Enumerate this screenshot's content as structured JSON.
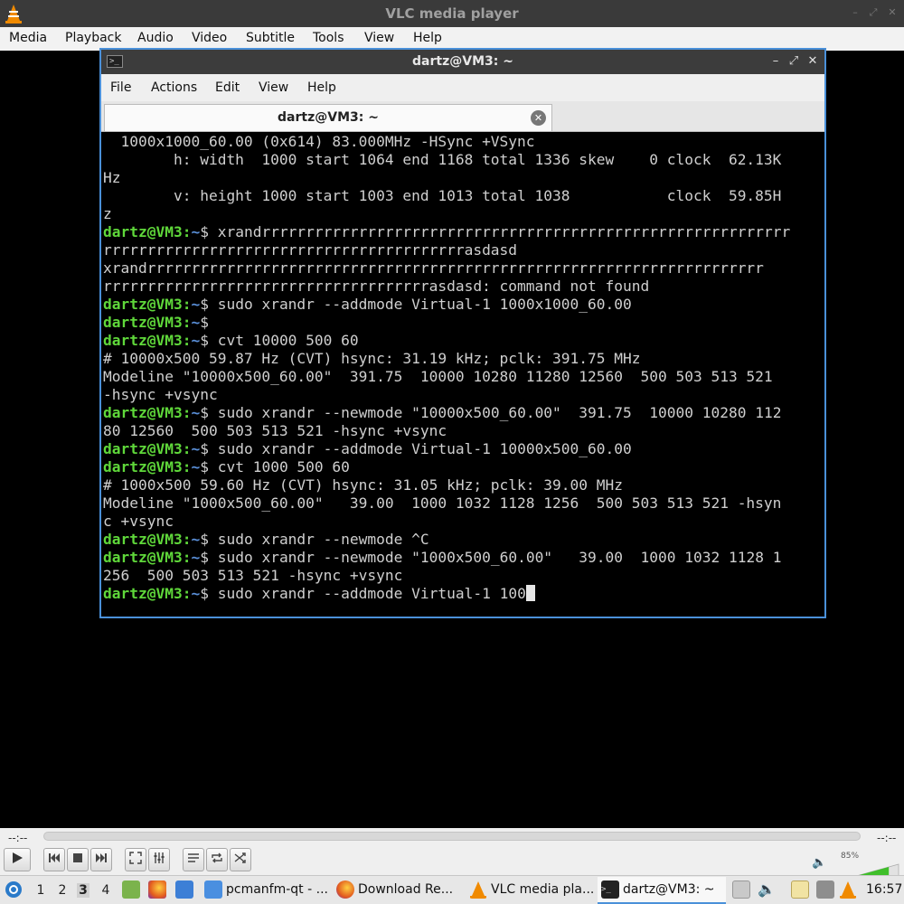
{
  "vlc": {
    "title": "VLC media player",
    "menu": [
      "Media",
      "Playback",
      "Audio",
      "Video",
      "Subtitle",
      "Tools",
      "View",
      "Help"
    ],
    "time_elapsed": "--:--",
    "time_total": "--:--",
    "volume": "85%",
    "volume_level": 0.85
  },
  "terminal": {
    "title": "dartz@VM3: ~",
    "menu": [
      "File",
      "Actions",
      "Edit",
      "View",
      "Help"
    ],
    "tab_label": "dartz@VM3: ~",
    "prompt_user": "dartz@VM3",
    "prompt_sep": ":",
    "prompt_path": "~",
    "prompt_dollar": "$ ",
    "lines": [
      {
        "type": "out",
        "text": "  1000x1000_60.00 (0x614) 83.000MHz -HSync +VSync"
      },
      {
        "type": "out",
        "text": "        h: width  1000 start 1064 end 1168 total 1336 skew    0 clock  62.13K"
      },
      {
        "type": "out",
        "text": "Hz"
      },
      {
        "type": "out",
        "text": "        v: height 1000 start 1003 end 1013 total 1038           clock  59.85H"
      },
      {
        "type": "out",
        "text": "z"
      },
      {
        "type": "cmd",
        "text": "xrandrrrrrrrrrrrrrrrrrrrrrrrrrrrrrrrrrrrrrrrrrrrrrrrrrrrrrrrrrrrr"
      },
      {
        "type": "out",
        "text": "rrrrrrrrrrrrrrrrrrrrrrrrrrrrrrrrrrrrrrrrrasdasd"
      },
      {
        "type": "out",
        "text": "xrandrrrrrrrrrrrrrrrrrrrrrrrrrrrrrrrrrrrrrrrrrrrrrrrrrrrrrrrrrrrrrrrrrrrrrr"
      },
      {
        "type": "out",
        "text": "rrrrrrrrrrrrrrrrrrrrrrrrrrrrrrrrrrrrrasdasd: command not found"
      },
      {
        "type": "cmd",
        "text": "sudo xrandr --addmode Virtual-1 1000x1000_60.00"
      },
      {
        "type": "cmd",
        "text": ""
      },
      {
        "type": "cmd",
        "text": "cvt 10000 500 60"
      },
      {
        "type": "out",
        "text": "# 10000x500 59.87 Hz (CVT) hsync: 31.19 kHz; pclk: 391.75 MHz"
      },
      {
        "type": "out",
        "text": "Modeline \"10000x500_60.00\"  391.75  10000 10280 11280 12560  500 503 513 521"
      },
      {
        "type": "out",
        "text": "-hsync +vsync"
      },
      {
        "type": "cmd",
        "text": "sudo xrandr --newmode \"10000x500_60.00\"  391.75  10000 10280 112"
      },
      {
        "type": "out",
        "text": "80 12560  500 503 513 521 -hsync +vsync"
      },
      {
        "type": "cmd",
        "text": "sudo xrandr --addmode Virtual-1 10000x500_60.00"
      },
      {
        "type": "cmd",
        "text": "cvt 1000 500 60"
      },
      {
        "type": "out",
        "text": "# 1000x500 59.60 Hz (CVT) hsync: 31.05 kHz; pclk: 39.00 MHz"
      },
      {
        "type": "out",
        "text": "Modeline \"1000x500_60.00\"   39.00  1000 1032 1128 1256  500 503 513 521 -hsyn"
      },
      {
        "type": "out",
        "text": "c +vsync"
      },
      {
        "type": "cmd",
        "text": "sudo xrandr --newmode ^C"
      },
      {
        "type": "cmd",
        "text": "sudo xrandr --newmode \"1000x500_60.00\"   39.00  1000 1032 1128 1"
      },
      {
        "type": "out",
        "text": "256  500 503 513 521 -hsync +vsync"
      },
      {
        "type": "cmd",
        "text": "sudo xrandr --addmode Virtual-1 100",
        "cursor": true
      }
    ]
  },
  "taskbar": {
    "workspaces": [
      "1",
      "2",
      "3",
      "4"
    ],
    "active_workspace": "3",
    "tasks": [
      "pcmanfm-qt - ...",
      "Download Re...",
      "VLC media pla...",
      "dartz@VM3: ~"
    ],
    "clock": "16:57"
  }
}
